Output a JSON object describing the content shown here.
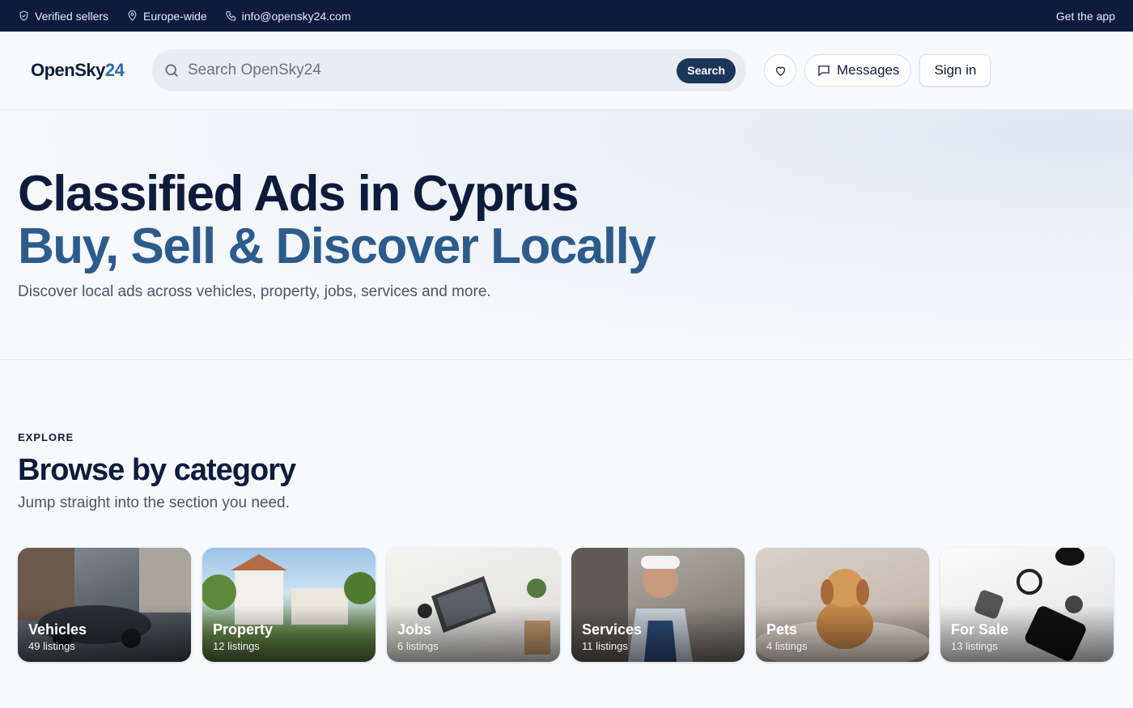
{
  "topbar": {
    "verified": "Verified sellers",
    "region": "Europe-wide",
    "email": "info@opensky24.com",
    "app": "Get the app"
  },
  "header": {
    "logo_main": "OpenSky",
    "logo_num": "24",
    "search_placeholder": "Search OpenSky24",
    "search_button": "Search",
    "messages": "Messages",
    "signin": "Sign in"
  },
  "hero": {
    "title": "Classified Ads in Cyprus",
    "subtitle": "Buy, Sell & Discover Locally",
    "description": "Discover local ads across vehicles, property, jobs, services and more."
  },
  "categories": {
    "eyebrow": "EXPLORE",
    "title": "Browse by category",
    "subtitle": "Jump straight into the section you need.",
    "items": [
      {
        "name": "Vehicles",
        "count": "49 listings"
      },
      {
        "name": "Property",
        "count": "12 listings"
      },
      {
        "name": "Jobs",
        "count": "6 listings"
      },
      {
        "name": "Services",
        "count": "11 listings"
      },
      {
        "name": "Pets",
        "count": "4 listings"
      },
      {
        "name": "For Sale",
        "count": "13 listings"
      }
    ]
  }
}
